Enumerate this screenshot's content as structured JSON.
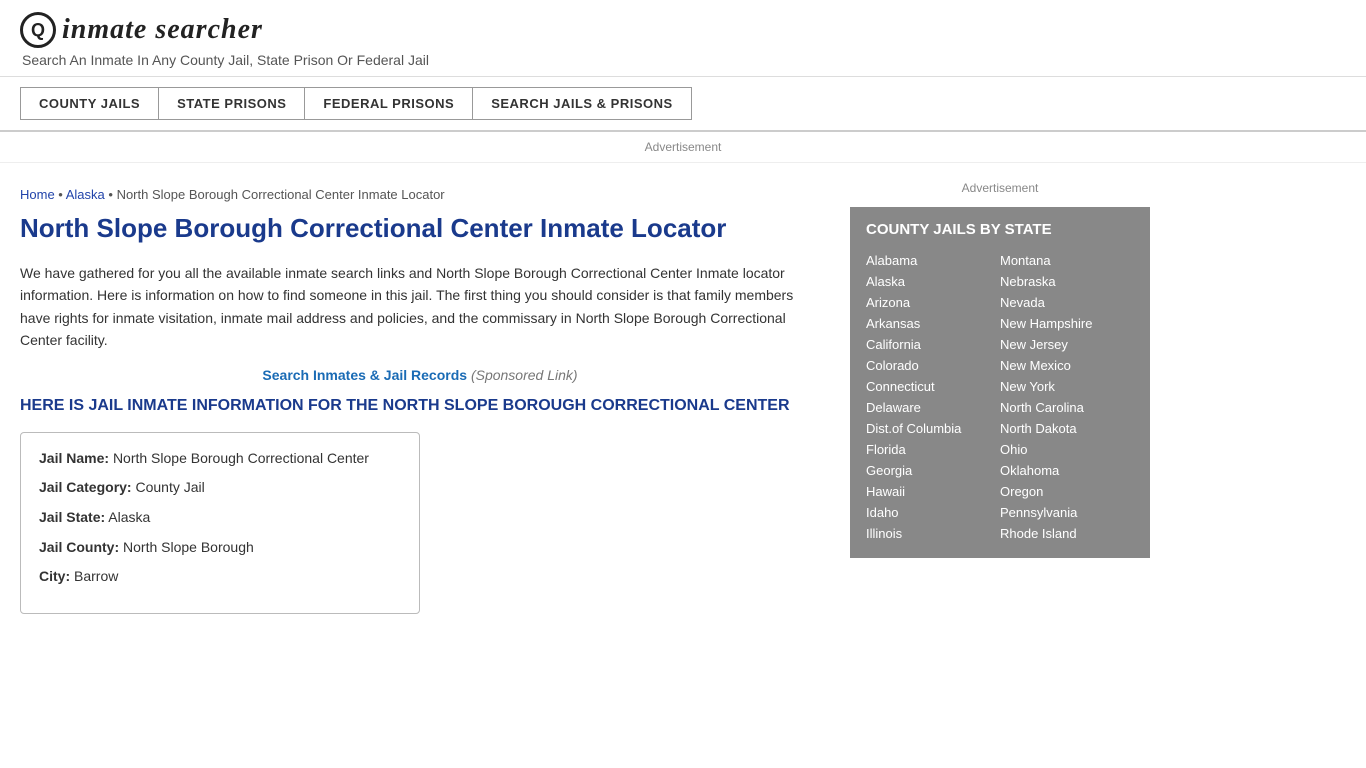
{
  "header": {
    "logo_icon": "Q",
    "logo_text_part1": "inmate",
    "logo_text_part2": "searcher",
    "tagline": "Search An Inmate In Any County Jail, State Prison Or Federal Jail"
  },
  "nav": {
    "buttons": [
      {
        "id": "county-jails",
        "label": "COUNTY JAILS"
      },
      {
        "id": "state-prisons",
        "label": "STATE PRISONS"
      },
      {
        "id": "federal-prisons",
        "label": "FEDERAL PRISONS"
      },
      {
        "id": "search-jails",
        "label": "SEARCH JAILS & PRISONS"
      }
    ]
  },
  "ad_banner": "Advertisement",
  "breadcrumb": {
    "home_label": "Home",
    "home_href": "#",
    "separator1": " • ",
    "alaska_label": "Alaska",
    "alaska_href": "#",
    "separator2": " • ",
    "current": "North Slope Borough Correctional Center Inmate Locator"
  },
  "page_title": "North Slope Borough Correctional Center Inmate Locator",
  "body_text": "We have gathered for you all the available inmate search links and North Slope Borough Correctional Center Inmate locator information. Here is information on how to find someone in this jail. The first thing you should consider is that family members have rights for inmate visitation, inmate mail address and policies, and the commissary in North Slope Borough Correctional Center facility.",
  "sponsored": {
    "link_text": "Search Inmates & Jail Records",
    "suffix": " (Sponsored Link)"
  },
  "section_heading": "HERE IS JAIL INMATE INFORMATION FOR THE NORTH SLOPE BOROUGH CORRECTIONAL CENTER",
  "jail_info": {
    "name_label": "Jail Name:",
    "name_value": "North Slope Borough Correctional Center",
    "category_label": "Jail Category:",
    "category_value": "County Jail",
    "state_label": "Jail State:",
    "state_value": "Alaska",
    "county_label": "Jail County:",
    "county_value": "North Slope Borough",
    "city_label": "City:",
    "city_value": "Barrow"
  },
  "sidebar": {
    "ad_label": "Advertisement",
    "state_box_title": "COUNTY JAILS BY STATE",
    "states_col1": [
      "Alabama",
      "Alaska",
      "Arizona",
      "Arkansas",
      "California",
      "Colorado",
      "Connecticut",
      "Delaware",
      "Dist.of Columbia",
      "Florida",
      "Georgia",
      "Hawaii",
      "Idaho",
      "Illinois"
    ],
    "states_col2": [
      "Montana",
      "Nebraska",
      "Nevada",
      "New Hampshire",
      "New Jersey",
      "New Mexico",
      "New York",
      "North Carolina",
      "North Dakota",
      "Ohio",
      "Oklahoma",
      "Oregon",
      "Pennsylvania",
      "Rhode Island"
    ]
  }
}
